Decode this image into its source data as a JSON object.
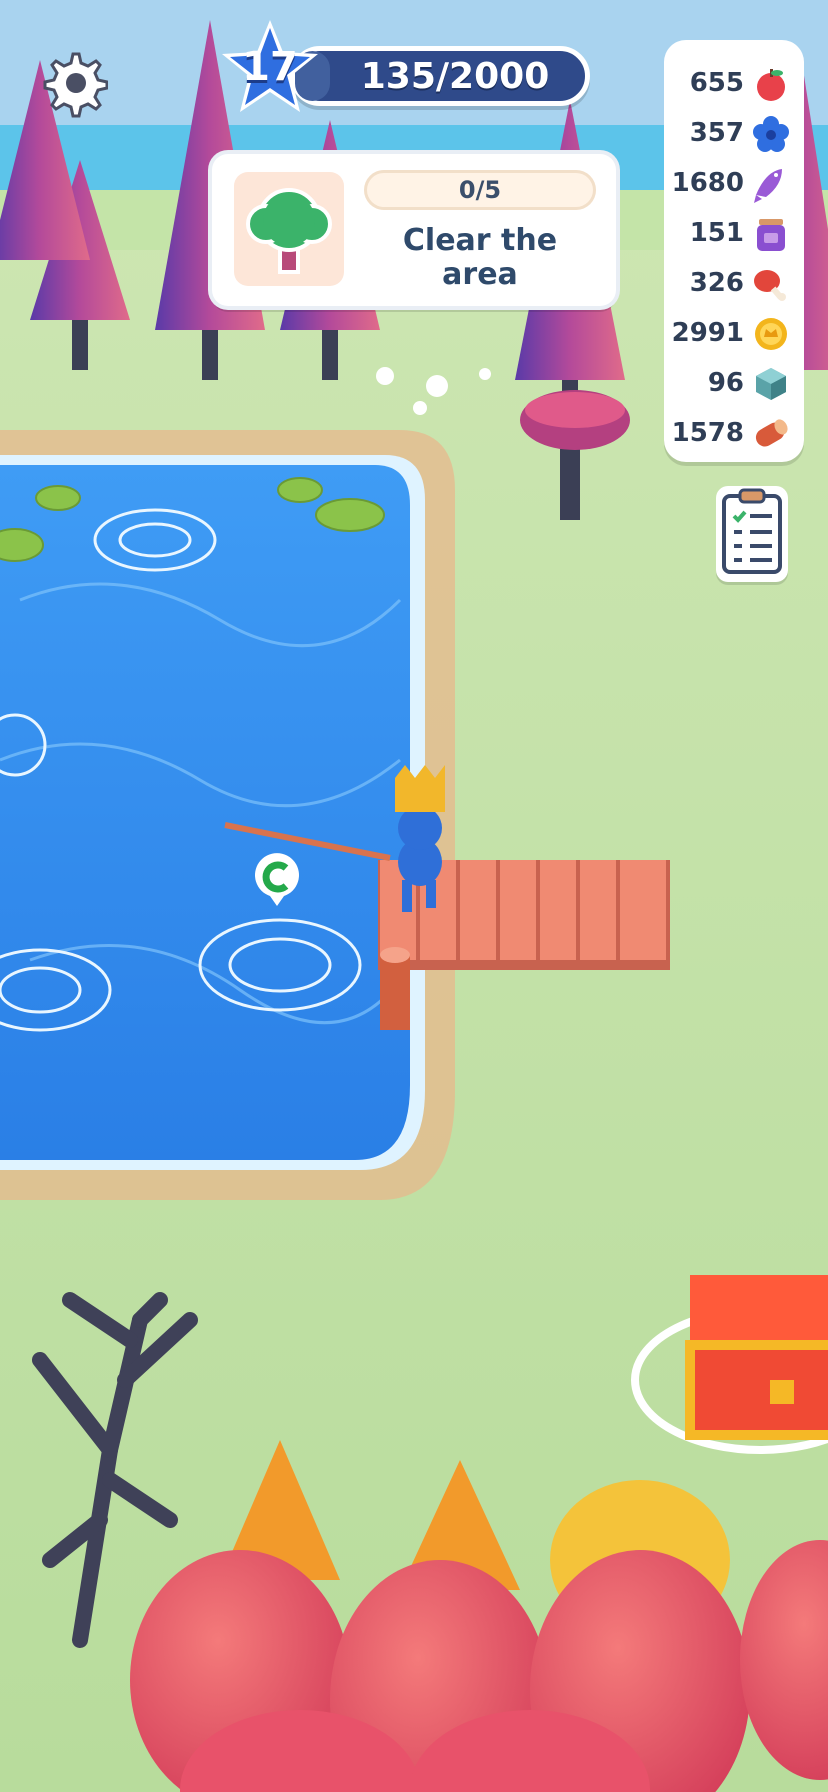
{
  "level": {
    "number": "17",
    "xp_text": "135/2000",
    "progress": 0.0675
  },
  "quest": {
    "progress_text": "0/5",
    "title": "Clear the area",
    "icon": "tree-icon"
  },
  "resources": [
    {
      "value": "655",
      "icon": "apple-icon",
      "color": "#e8414a"
    },
    {
      "value": "357",
      "icon": "blue-flower-icon",
      "color": "#2f6ee0"
    },
    {
      "value": "1680",
      "icon": "purple-fish-icon",
      "color": "#9a5ad6"
    },
    {
      "value": "151",
      "icon": "jam-jar-icon",
      "color": "#8a4fd0"
    },
    {
      "value": "326",
      "icon": "meat-leg-icon",
      "color": "#e2463b"
    },
    {
      "value": "2991",
      "icon": "gold-coin-icon",
      "color": "#f3b51c"
    },
    {
      "value": "96",
      "icon": "stone-cube-icon",
      "color": "#5aa3a8"
    },
    {
      "value": "1578",
      "icon": "wood-log-icon",
      "color": "#d85a3a"
    }
  ],
  "buttons": {
    "settings": "gear-icon",
    "tasks": "clipboard-icon"
  },
  "scene": {
    "water": "#2f8ff0",
    "grass": "#bfe3a6",
    "dock": "#f08a72"
  }
}
